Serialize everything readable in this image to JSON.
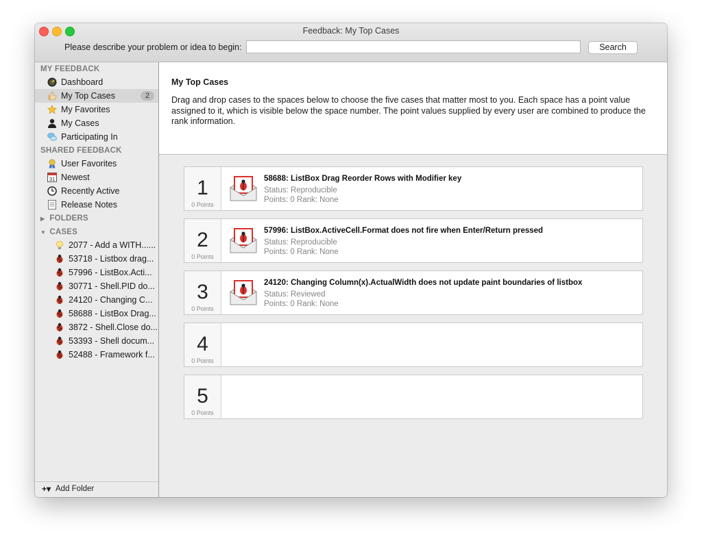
{
  "window": {
    "title": "Feedback: My Top Cases"
  },
  "toolbar": {
    "prompt": "Please describe your problem or idea to begin:",
    "search_value": "",
    "search_button": "Search"
  },
  "sidebar": {
    "my_feedback_header": "MY FEEDBACK",
    "shared_feedback_header": "SHARED FEEDBACK",
    "folders_header": "FOLDERS",
    "cases_header": "CASES",
    "my_feedback": [
      {
        "label": "Dashboard",
        "icon": "dashboard-icon"
      },
      {
        "label": "My Top Cases",
        "icon": "thumbs-up-icon",
        "badge": "2",
        "selected": true
      },
      {
        "label": "My Favorites",
        "icon": "star-icon"
      },
      {
        "label": "My Cases",
        "icon": "person-icon"
      },
      {
        "label": "Participating In",
        "icon": "speech-bubbles-icon"
      }
    ],
    "shared_feedback": [
      {
        "label": "User Favorites",
        "icon": "award-ribbon-icon"
      },
      {
        "label": "Newest",
        "icon": "calendar-icon",
        "icon_text": "31"
      },
      {
        "label": "Recently Active",
        "icon": "clock-icon"
      },
      {
        "label": "Release Notes",
        "icon": "document-icon"
      }
    ],
    "cases": [
      {
        "label": "2077 - Add a WITH......",
        "icon": "lightbulb-icon"
      },
      {
        "label": "53718 - Listbox drag...",
        "icon": "bug-icon"
      },
      {
        "label": "57996 - ListBox.Acti...",
        "icon": "bug-icon"
      },
      {
        "label": "30771 - Shell.PID do...",
        "icon": "bug-icon"
      },
      {
        "label": "24120 - Changing C...",
        "icon": "bug-icon"
      },
      {
        "label": "58688 - ListBox Drag...",
        "icon": "bug-icon"
      },
      {
        "label": "3872 - Shell.Close do...",
        "icon": "bug-icon"
      },
      {
        "label": "53393 - Shell docum...",
        "icon": "bug-icon"
      },
      {
        "label": "52488 - Framework f...",
        "icon": "bug-icon"
      }
    ],
    "add_folder": "Add Folder"
  },
  "main": {
    "title": "My Top Cases",
    "description": "Drag and drop cases to the spaces below to choose the five cases that matter most to you. Each space has a point value assigned to it, which is visible below the space number. The point values supplied by every user are combined to produce the rank information.",
    "slots": [
      {
        "number": "1",
        "points": "0 Points",
        "case": {
          "title": "58688: ListBox Drag Reorder Rows with Modifier key",
          "status": "Status: Reproducible",
          "points_rank": "Points: 0  Rank: None"
        }
      },
      {
        "number": "2",
        "points": "0 Points",
        "case": {
          "title": "57996: ListBox.ActiveCell.Format does not fire when Enter/Return pressed",
          "status": "Status: Reproducible",
          "points_rank": "Points: 0  Rank: None"
        }
      },
      {
        "number": "3",
        "points": "0 Points",
        "case": {
          "title": "24120: Changing Column(x).ActualWidth does not update paint boundaries of listbox",
          "status": "Status: Reviewed",
          "points_rank": "Points: 0  Rank: None"
        }
      },
      {
        "number": "4",
        "points": "0 Points"
      },
      {
        "number": "5",
        "points": "0 Points"
      }
    ]
  },
  "colors": {
    "selected_row": "#d7d7d7",
    "bug_red": "#d9302b",
    "badge": "#bdbdbd"
  }
}
